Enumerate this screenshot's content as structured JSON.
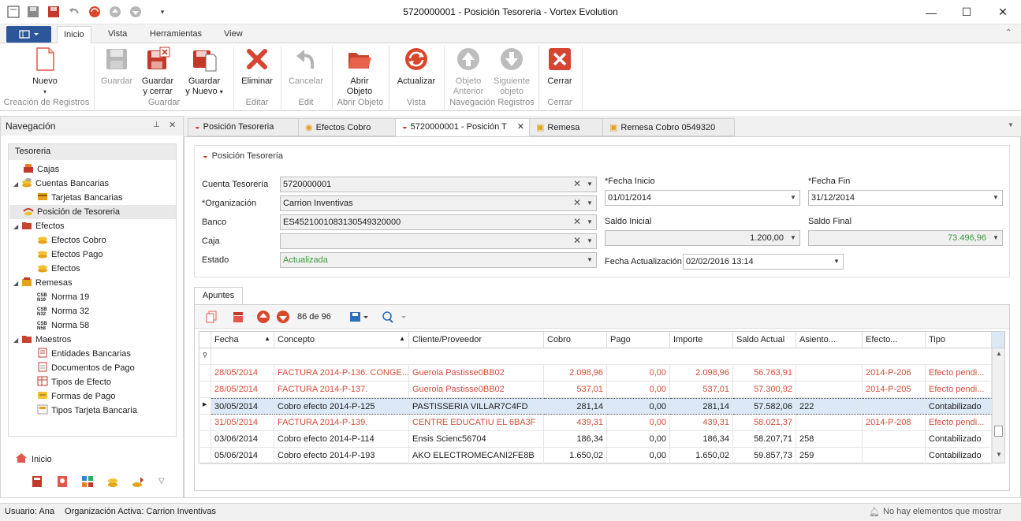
{
  "window": {
    "title": "5720000001 - Posición Tesoreria - Vortex Evolution"
  },
  "ribbon_tabs": [
    "Inicio",
    "Vista",
    "Herramientas",
    "View"
  ],
  "ribbon": {
    "nuevo": "Nuevo",
    "guardar": "Guardar",
    "guardar_cerrar": [
      "Guardar",
      "y cerrar"
    ],
    "guardar_nuevo": [
      "Guardar",
      "y Nuevo"
    ],
    "eliminar": "Eliminar",
    "cancelar": "Cancelar",
    "abrir": [
      "Abrir",
      "Objeto"
    ],
    "actualizar": "Actualizar",
    "objeto_anterior": [
      "Objeto",
      "Anterior"
    ],
    "siguiente_objeto": [
      "Siguiente",
      "objeto"
    ],
    "cerrar": "Cerrar",
    "groups": [
      "Creación de Registros",
      "Guardar",
      "Editar",
      "Edit",
      "Abrir Objeto",
      "Vista",
      "Navegación Registros",
      "Cerrar"
    ]
  },
  "nav": {
    "title": "Navegación",
    "section": "Tesoreria",
    "items": [
      "Cajas",
      "Cuentas Bancarias",
      "Tarjetas Bancarias",
      "Posición de Tesoreria",
      "Efectos",
      "Efectos Cobro",
      "Efectos Pago",
      "Efectos",
      "Remesas",
      "Norma 19",
      "Norma 32",
      "Norma 58",
      "Maestros",
      "Entidades Bancarias",
      "Documentos de Pago",
      "Tipos de Efecto",
      "Formas de Pago",
      "Tipos Tarjeta Bancaria"
    ],
    "home": "Inicio"
  },
  "doc_tabs": [
    "Posición Tesoreria",
    "Efectos Cobro",
    "5720000001 - Posición T",
    "Remesa",
    "Remesa Cobro 0549320"
  ],
  "form": {
    "header": "Posición Tesorería",
    "cuenta_label": "Cuenta Tesorería",
    "cuenta_value": "5720000001",
    "org_label": "*Organización",
    "org_value": "Carrion Inventivas",
    "banco_label": "Banco",
    "banco_value": "ES4521001083130549320000",
    "caja_label": "Caja",
    "caja_value": "",
    "estado_label": "Estado",
    "estado_value": "Actualizada",
    "fecha_inicio_label": "*Fecha Inicio",
    "fecha_inicio_value": "01/01/2014",
    "fecha_fin_label": "*Fecha Fin",
    "fecha_fin_value": "31/12/2014",
    "saldo_inicial_label": "Saldo Inicial",
    "saldo_inicial_value": "1.200,00",
    "saldo_final_label": "Saldo Final",
    "saldo_final_value": "73.496,96",
    "fecha_act_label": "Fecha Actualización",
    "fecha_act_value": "02/02/2016 13:14"
  },
  "apuntes": {
    "tab": "Apuntes",
    "counter": "86 de 96",
    "columns": [
      "Fecha",
      "Concepto",
      "Cliente/Proveedor",
      "Cobro",
      "Pago",
      "Importe",
      "Saldo Actual",
      "Asiento...",
      "Efecto...",
      "Tipo"
    ],
    "rows": [
      {
        "fecha": "28/05/2014",
        "concepto": "FACTURA 2014-P-136. CONGE...",
        "cliente": "Guerola Pastisse0BB02",
        "cobro": "2.098,96",
        "pago": "0,00",
        "importe": "2.098,96",
        "saldo": "56.763,91",
        "asiento": "",
        "efecto": "2014-P-206",
        "tipo": "Efecto pendi...",
        "red": true
      },
      {
        "fecha": "28/05/2014",
        "concepto": "FACTURA 2014-P-137.",
        "cliente": "Guerola Pastisse0BB02",
        "cobro": "537,01",
        "pago": "0,00",
        "importe": "537,01",
        "saldo": "57.300,92",
        "asiento": "",
        "efecto": "2014-P-205",
        "tipo": "Efecto pendi...",
        "red": true
      },
      {
        "fecha": "30/05/2014",
        "concepto": "Cobro efecto 2014-P-125",
        "cliente": "PASTISSERIA VILLAR7C4FD",
        "cobro": "281,14",
        "pago": "0,00",
        "importe": "281,14",
        "saldo": "57.582,06",
        "asiento": "222",
        "efecto": "",
        "tipo": "Contabilizado",
        "red": false
      },
      {
        "fecha": "31/05/2014",
        "concepto": "FACTURA 2014-P-139.",
        "cliente": "CENTRE EDUCATIU EL 6BA3F",
        "cobro": "439,31",
        "pago": "0,00",
        "importe": "439,31",
        "saldo": "58.021,37",
        "asiento": "",
        "efecto": "2014-P-208",
        "tipo": "Efecto pendi...",
        "red": true
      },
      {
        "fecha": "03/06/2014",
        "concepto": "Cobro efecto 2014-P-114",
        "cliente": "Ensis Scienc56704",
        "cobro": "186,34",
        "pago": "0,00",
        "importe": "186,34",
        "saldo": "58.207,71",
        "asiento": "258",
        "efecto": "",
        "tipo": "Contabilizado",
        "red": false
      },
      {
        "fecha": "05/06/2014",
        "concepto": "Cobro efecto 2014-P-193",
        "cliente": "AKO ELECTROMECANI2FE8B",
        "cobro": "1.650,02",
        "pago": "0,00",
        "importe": "1.650,02",
        "saldo": "59.857,73",
        "asiento": "259",
        "efecto": "",
        "tipo": "Contabilizado",
        "red": false
      }
    ]
  },
  "status": {
    "user": "Usuario: Ana",
    "org": "Organización Activa: Carrion Inventivas",
    "notif": "No hay elementos que mostrar"
  },
  "colors": {
    "accent": "#2b579a",
    "red_row": "#d74b3a",
    "green_text": "#3c9a3c",
    "selected_row": "#dbe8f7"
  }
}
